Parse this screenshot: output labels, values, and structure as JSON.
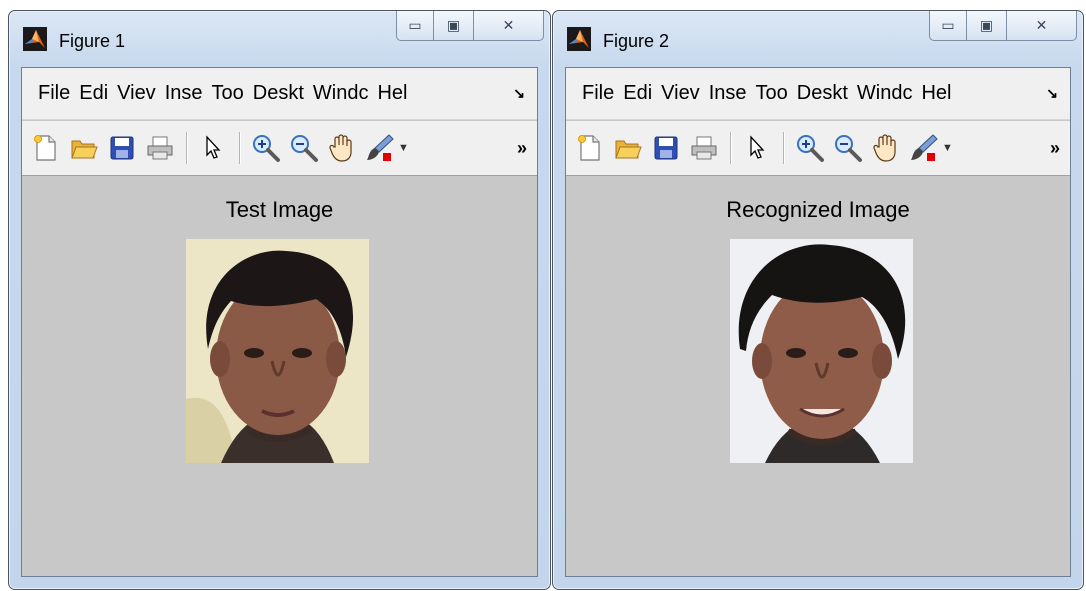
{
  "windows": [
    {
      "title": "Figure 1",
      "menus": [
        "File",
        "Edi",
        "Viev",
        "Inse",
        "Too",
        "Deskt",
        "Windc",
        "Hel"
      ],
      "axes_title": "Test Image"
    },
    {
      "title": "Figure 2",
      "menus": [
        "File",
        "Edi",
        "Viev",
        "Inse",
        "Too",
        "Deskt",
        "Windc",
        "Hel"
      ],
      "axes_title": "Recognized Image"
    }
  ],
  "caption_buttons": {
    "minimize": "▭",
    "maximize": "▣",
    "close": "✕"
  },
  "menu_overflow": "↘",
  "toolbar_overflow": "»",
  "toolbar_tools": [
    "new-file-icon",
    "open-folder-icon",
    "save-icon",
    "print-icon",
    "pointer-icon",
    "zoom-in-icon",
    "zoom-out-icon",
    "pan-hand-icon",
    "brush-icon"
  ],
  "colors": {
    "title_bar": "#c7d9ee",
    "menu_bg": "#f0f0f0",
    "figure_bg": "#c8c8c8",
    "brush_marker": "#e00000"
  }
}
